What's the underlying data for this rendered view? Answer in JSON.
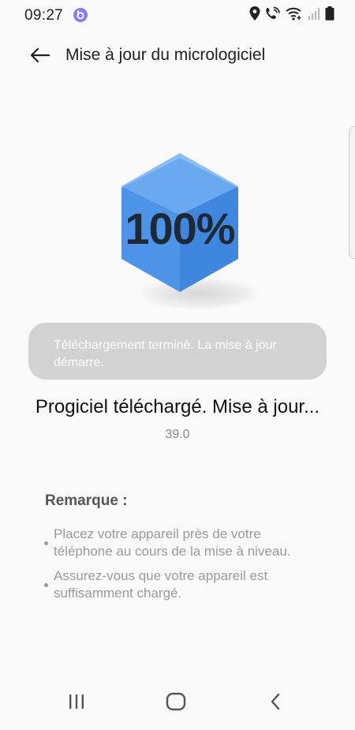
{
  "status_bar": {
    "time": "09:27",
    "icons": [
      "app-notification-icon",
      "location-icon",
      "wifi-calling-icon",
      "wifi-icon",
      "signal-icon",
      "battery-icon"
    ]
  },
  "header": {
    "title": "Mise à jour du micrologiciel",
    "back_icon": "back-arrow-icon"
  },
  "progress": {
    "percent_label": "100%",
    "value": 1.0,
    "cube_color": "#4d94e8"
  },
  "toast": {
    "message": "Téléchargement terminé. La mise à jour démarre."
  },
  "status": {
    "message": "Progiciel téléchargé. Mise à jour...",
    "version": "39.0"
  },
  "notes": {
    "title": "Remarque :",
    "items": [
      "Placez votre appareil près de votre téléphone au cours de la mise à niveau.",
      "Assurez-vous que votre appareil est suffisamment chargé."
    ]
  },
  "nav_bar": {
    "recents_icon": "recents-icon",
    "home_icon": "home-icon",
    "back_icon": "nav-back-icon"
  }
}
